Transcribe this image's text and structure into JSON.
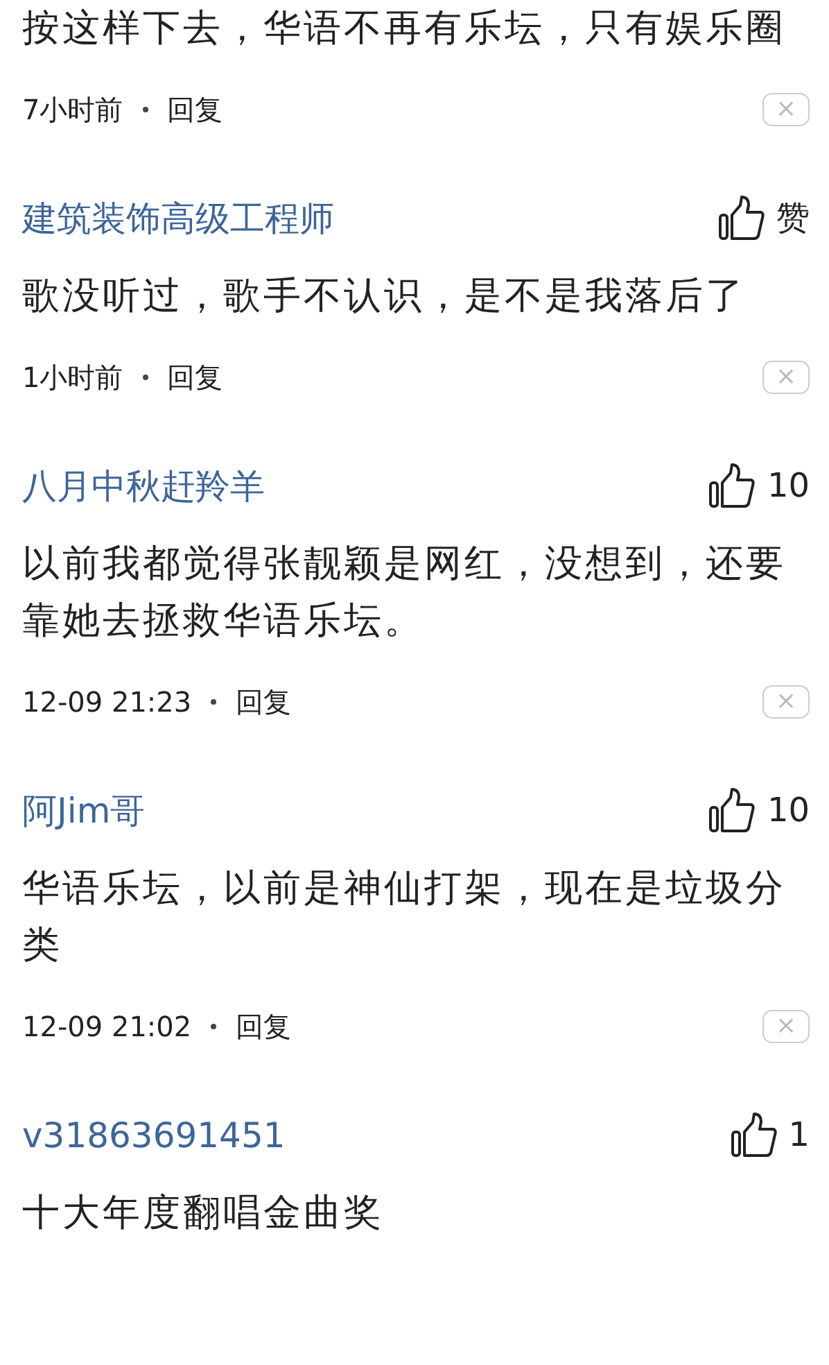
{
  "comments": [
    {
      "text": "按这样下去，华语不再有乐坛，只有娱乐圈",
      "time": "7小时前",
      "reply": "回复",
      "close": "×"
    },
    {
      "author": "建筑装饰高级工程师",
      "likes": "赞",
      "text": "歌没听过，歌手不认识，是不是我落后了",
      "time": "1小时前",
      "reply": "回复",
      "close": "×"
    },
    {
      "author": "八月中秋赶羚羊",
      "likes": "10",
      "text": "以前我都觉得张靓颖是网红，没想到，还要靠她去拯救华语乐坛。",
      "time": "12-09 21:23",
      "reply": "回复",
      "close": "×"
    },
    {
      "author": "阿Jim哥",
      "likes": "10",
      "text": "华语乐坛，以前是神仙打架，现在是垃圾分类",
      "time": "12-09 21:02",
      "reply": "回复",
      "close": "×"
    },
    {
      "author": "v31863691451",
      "likes": "1",
      "text": "十大年度翻唱金曲奖"
    }
  ]
}
